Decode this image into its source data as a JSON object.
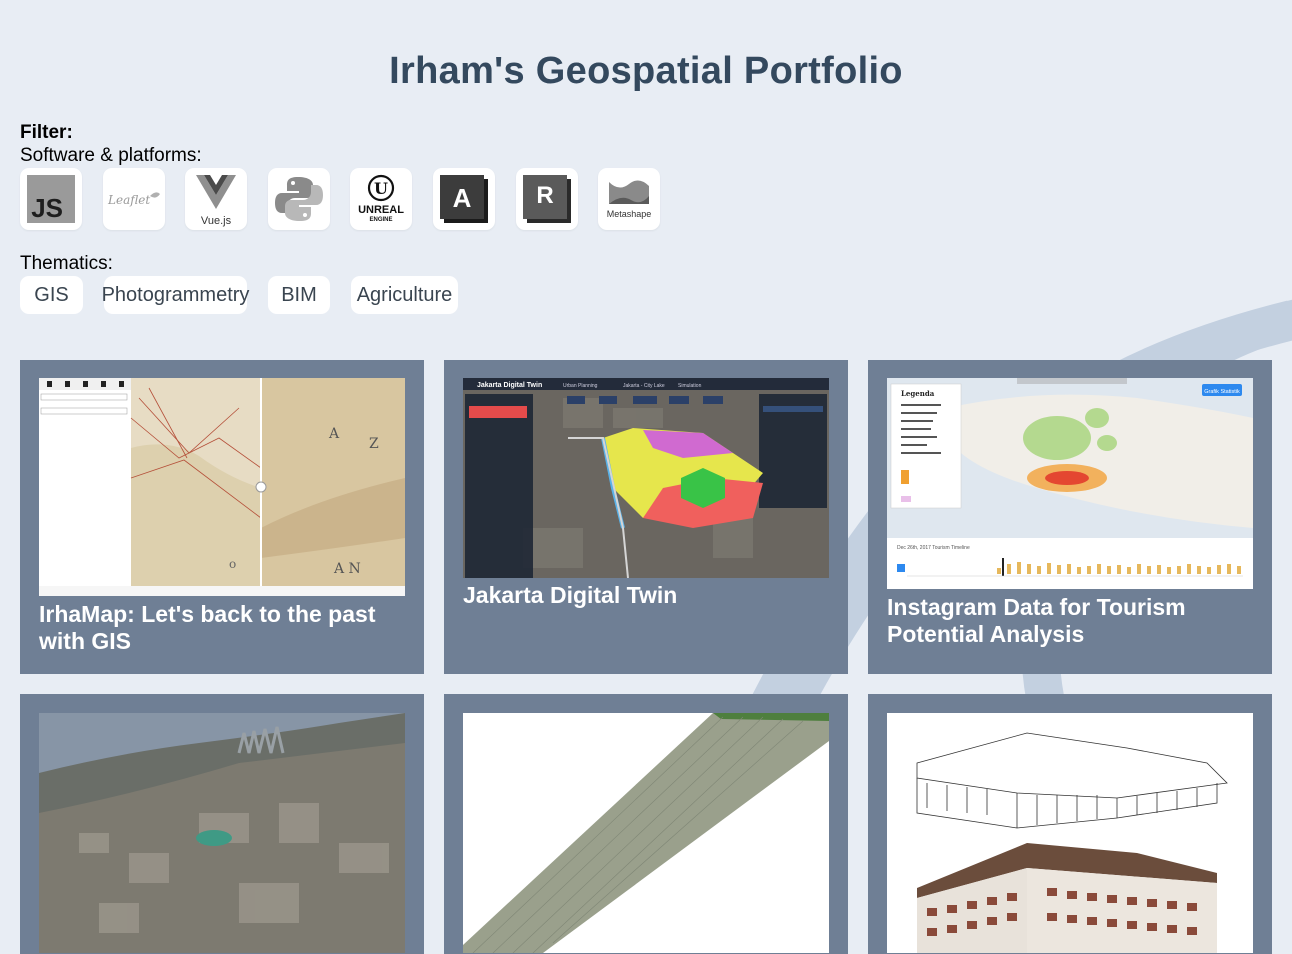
{
  "title": "Irham's Geospatial Portfolio",
  "filter": {
    "heading": "Filter:",
    "software_label": "Software & platforms:",
    "software": [
      {
        "name": "JavaScript",
        "icon": "js-icon",
        "text": "JS"
      },
      {
        "name": "Leaflet",
        "icon": "leaflet-icon",
        "text": "Leaflet"
      },
      {
        "name": "Vue.js",
        "icon": "vuejs-icon",
        "text": "Vue.js"
      },
      {
        "name": "Python",
        "icon": "python-icon"
      },
      {
        "name": "Unreal Engine",
        "icon": "unreal-engine-icon",
        "text": "UNREAL",
        "subtext": "ENGINE"
      },
      {
        "name": "ArcGIS / Autodesk",
        "icon": "a-logo-icon",
        "text": "A"
      },
      {
        "name": "Revit",
        "icon": "revit-icon",
        "text": "R"
      },
      {
        "name": "Metashape",
        "icon": "metashape-icon",
        "text": "Metashape"
      }
    ],
    "thematics_label": "Thematics:",
    "thematics": [
      "GIS",
      "Photogrammetry",
      "BIM",
      "Agriculture"
    ]
  },
  "projects": [
    {
      "title": "IrhaMap: Let's back to the past with GIS",
      "thumb": "historic-map-thumbnail"
    },
    {
      "title": "Jakarta Digital Twin",
      "thumb": "digital-twin-thumbnail",
      "app_name": "Jakarta Digital Twin",
      "tabs": [
        "Urban Planning",
        "Jakarta - City Lake",
        "Simulation"
      ]
    },
    {
      "title": "Instagram Data for Tourism Potential Analysis",
      "thumb": "tourism-map-thumbnail",
      "legend_title": "Legenda",
      "button": "Grafik Statistik",
      "timeline_label": "Dec 26th, 2017  Tourism Timeline"
    },
    {
      "title": "",
      "thumb": "coastal-city-orthophoto-thumbnail"
    },
    {
      "title": "",
      "thumb": "agricultural-field-orthomosaic-thumbnail"
    },
    {
      "title": "",
      "thumb": "bim-building-model-thumbnail"
    }
  ],
  "colors": {
    "background": "#e8edf4",
    "title": "#34495e",
    "card": "#6f7f95"
  }
}
